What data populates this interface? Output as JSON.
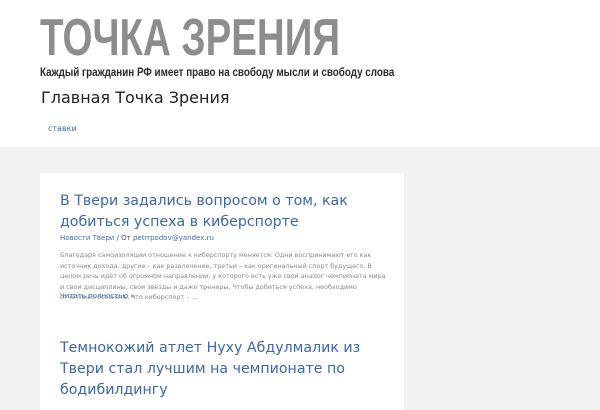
{
  "logo": {
    "title": "ТОЧКА ЗРЕНИЯ",
    "tagline": "Каждый гражданин РФ имеет право на свободу мысли и свободу слова"
  },
  "site": {
    "title": "Главная Точка Зрения"
  },
  "menu": {
    "items": [
      "ставки"
    ]
  },
  "posts": [
    {
      "title": "В Твери задались вопросом о том, как добиться успеха в киберспорте",
      "category": "Новости Твери",
      "separator": " / От ",
      "author": "petrrpodov@yandex.ru",
      "excerpt": "Благодаря самоизоляции отношение к киберспорту меняется. Одни воспринимают его как источник дохода, другие – как развлечение, третьи – как оригинальный спорт будущего. В целом речь идёт об огромном направлении, у которого есть уже свой аналог чемпионата мира и свои дисциплины, свои звёзды и даже тренеры.     Чтобы добиться успеха, необходимо отчётливо осознать, что киберспорт – …",
      "read_more": "Читать полностью »"
    },
    {
      "title": "Темнокожий атлет Нуху Абдулмалик из Твери стал лучшим на чемпионате по бодибилдингу"
    }
  ]
}
